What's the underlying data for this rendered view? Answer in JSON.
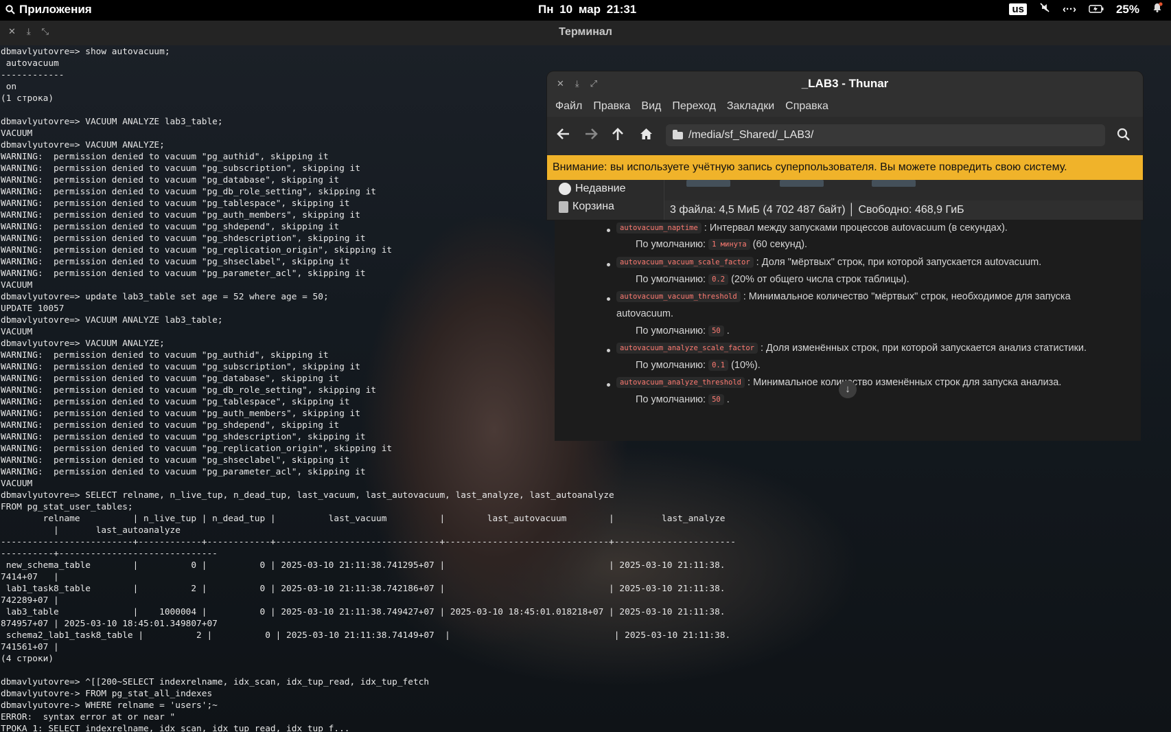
{
  "topbar": {
    "apps_label": "Приложения",
    "date": "Пн 10 мар",
    "time": "21:31",
    "keyboard_layout": "us",
    "battery_percent": "25%"
  },
  "terminal": {
    "title": "Терминал",
    "lines": [
      "dbmavlyutovre=> show autovacuum;",
      " autovacuum",
      "------------",
      " on",
      "(1 строка)",
      "",
      "dbmavlyutovre=> VACUUM ANALYZE lab3_table;",
      "VACUUM",
      "dbmavlyutovre=> VACUUM ANALYZE;",
      "WARNING:  permission denied to vacuum \"pg_authid\", skipping it",
      "WARNING:  permission denied to vacuum \"pg_subscription\", skipping it",
      "WARNING:  permission denied to vacuum \"pg_database\", skipping it",
      "WARNING:  permission denied to vacuum \"pg_db_role_setting\", skipping it",
      "WARNING:  permission denied to vacuum \"pg_tablespace\", skipping it",
      "WARNING:  permission denied to vacuum \"pg_auth_members\", skipping it",
      "WARNING:  permission denied to vacuum \"pg_shdepend\", skipping it",
      "WARNING:  permission denied to vacuum \"pg_shdescription\", skipping it",
      "WARNING:  permission denied to vacuum \"pg_replication_origin\", skipping it",
      "WARNING:  permission denied to vacuum \"pg_shseclabel\", skipping it",
      "WARNING:  permission denied to vacuum \"pg_parameter_acl\", skipping it",
      "VACUUM",
      "dbmavlyutovre=> update lab3_table set age = 52 where age = 50;",
      "UPDATE 10057",
      "dbmavlyutovre=> VACUUM ANALYZE lab3_table;",
      "VACUUM",
      "dbmavlyutovre=> VACUUM ANALYZE;",
      "WARNING:  permission denied to vacuum \"pg_authid\", skipping it",
      "WARNING:  permission denied to vacuum \"pg_subscription\", skipping it",
      "WARNING:  permission denied to vacuum \"pg_database\", skipping it",
      "WARNING:  permission denied to vacuum \"pg_db_role_setting\", skipping it",
      "WARNING:  permission denied to vacuum \"pg_tablespace\", skipping it",
      "WARNING:  permission denied to vacuum \"pg_auth_members\", skipping it",
      "WARNING:  permission denied to vacuum \"pg_shdepend\", skipping it",
      "WARNING:  permission denied to vacuum \"pg_shdescription\", skipping it",
      "WARNING:  permission denied to vacuum \"pg_replication_origin\", skipping it",
      "WARNING:  permission denied to vacuum \"pg_shseclabel\", skipping it",
      "WARNING:  permission denied to vacuum \"pg_parameter_acl\", skipping it",
      "VACUUM",
      "dbmavlyutovre=> SELECT relname, n_live_tup, n_dead_tup, last_vacuum, last_autovacuum, last_analyze, last_autoanalyze",
      "FROM pg_stat_user_tables;",
      "        relname          | n_live_tup | n_dead_tup |          last_vacuum          |        last_autovacuum        |         last_analyze",
      "          |       last_autoanalyze",
      "-------------------------+------------+------------+-------------------------------+-------------------------------+-----------------------",
      "----------+------------------------------",
      " new_schema_table        |          0 |          0 | 2025-03-10 21:11:38.741295+07 |                               | 2025-03-10 21:11:38.",
      "7414+07   |",
      " lab1_task8_table        |          2 |          0 | 2025-03-10 21:11:38.742186+07 |                               | 2025-03-10 21:11:38.",
      "742289+07 |",
      " lab3_table              |    1000004 |          0 | 2025-03-10 21:11:38.749427+07 | 2025-03-10 18:45:01.018218+07 | 2025-03-10 21:11:38.",
      "874957+07 | 2025-03-10 18:45:01.349807+07",
      " schema2_lab1_task8_table |          2 |          0 | 2025-03-10 21:11:38.74149+07  |                               | 2025-03-10 21:11:38.",
      "741561+07 |",
      "(4 строки)",
      "",
      "dbmavlyutovre=> ^[[200~SELECT indexrelname, idx_scan, idx_tup_read, idx_tup_fetch",
      "dbmavlyutovre-> FROM pg_stat_all_indexes",
      "dbmavlyutovre-> WHERE relname = 'users';~",
      "ERROR:  syntax error at or near \"",
      "ТРОКА 1: SELECT indexrelname, idx_scan, idx_tup_read, idx_tup_f..."
    ]
  },
  "thunar": {
    "title": "_LAB3 - Thunar",
    "menu": [
      "Файл",
      "Правка",
      "Вид",
      "Переход",
      "Закладки",
      "Справка"
    ],
    "path": "/media/sf_Shared/_LAB3/",
    "warning": "Внимание: вы используете учётную запись суперпользователя. Вы можете повредить свою систему.",
    "sidebar": [
      "Недавние",
      "Корзина"
    ],
    "status": "3 файла: 4,5 МиБ (4 702 487 байт)  │  Свободно: 468,9 ГиБ",
    "warning_color": "#f0b32a"
  },
  "doc": {
    "items": [
      {
        "code": "autovacuum_naptime",
        "text": ": Интервал между запусками процессов autovacuum (в секундах).",
        "default_label": "По умолчанию:",
        "default_code": "1 минута",
        "default_note": "(60 секунд)."
      },
      {
        "code": "autovacuum_vacuum_scale_factor",
        "text": ": Доля \"мёртвых\" строк, при которой запускается autovacuum.",
        "default_label": "По умолчанию:",
        "default_code": "0.2",
        "default_note": "(20% от общего числа строк таблицы)."
      },
      {
        "code": "autovacuum_vacuum_threshold",
        "text": ": Минимальное количество \"мёртвых\" строк, необходимое для запуска",
        "text2": "autovacuum.",
        "default_label": "По умолчанию:",
        "default_code": "50",
        "default_note": "."
      },
      {
        "code": "autovacuum_analyze_scale_factor",
        "text": ": Доля изменённых строк, при которой запускается анализ статистики.",
        "default_label": "По умолчанию:",
        "default_code": "0.1",
        "default_note": "(10%)."
      },
      {
        "code": "autovacuum_analyze_threshold",
        "text": ": Минимальное количество изменённых строк для запуска анализа.",
        "default_label": "По умолчанию:",
        "default_code": "50",
        "default_note": "."
      }
    ]
  }
}
